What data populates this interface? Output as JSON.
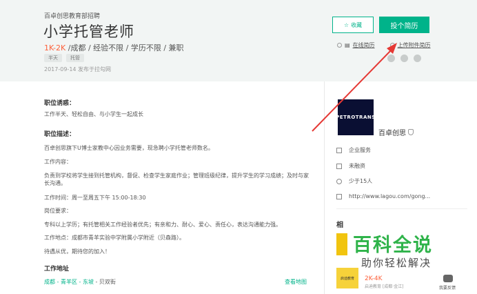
{
  "header": {
    "company": "百卓创思教育部招聘",
    "title": "小学托管老师",
    "salary": "1K-2K",
    "meta_rest": " /成都 / 经验不限 / 学历不限 / 兼职",
    "tags": [
      "半天",
      "托管"
    ],
    "published": "2017-09-14  发布于拉勾网",
    "collect_label": "收藏",
    "apply_label": "投个简历",
    "resume_online": "在线简历",
    "resume_upload": "上传附件简历"
  },
  "content": {
    "perks_title": "职位诱惑：",
    "perks_text": "工作半天、轻松自由、与小学生一起成长",
    "desc_title": "职位描述：",
    "desc_intro": "百卓创思旗下U博士家教中心因业务需要，现急聘小学托管老师数名。",
    "work_content_label": "工作内容：",
    "work_content": "负责到学校将学生接到托管机构，督促、检查学生家庭作业；管理班级纪律，提升学生的学习成绩；及时与家长沟通。",
    "work_time": "工作时间：周一至周五下午 15:00-18:30",
    "req_label": "岗位要求：",
    "req_text": "专科以上学历；有托管相关工作经验者优先；有亲和力、耐心、爱心、责任心，表达沟通能力强。",
    "work_place": "工作地点：成都市青羊实验中学附属小学附近（贝森路）。",
    "closing": "待遇从优，期待您的加入！",
    "address_title": "工作地址",
    "address_links": "成都 - 青羊区 - 东坡",
    "address_rest": " - 贝双街",
    "map_link": "查看地图"
  },
  "sidebar": {
    "logo_text": "PETROTRANS",
    "company_name": "百卓创思",
    "industry": "企业服务",
    "financing": "未融资",
    "size": "少于15人",
    "website": "http://www.lagou.com/gong...",
    "related_head": "相",
    "related_salary": "2K-4K",
    "related_company": "启迪教育 [成都·金江]",
    "related_img_text": "启迪教育"
  },
  "watermark": {
    "big": "百科全说",
    "small": "助你轻松解决"
  },
  "feedback": "我要反馈",
  "colors": {
    "accent": "#00b38a",
    "salary": "#fd5f39",
    "arrow": "#e53935"
  }
}
